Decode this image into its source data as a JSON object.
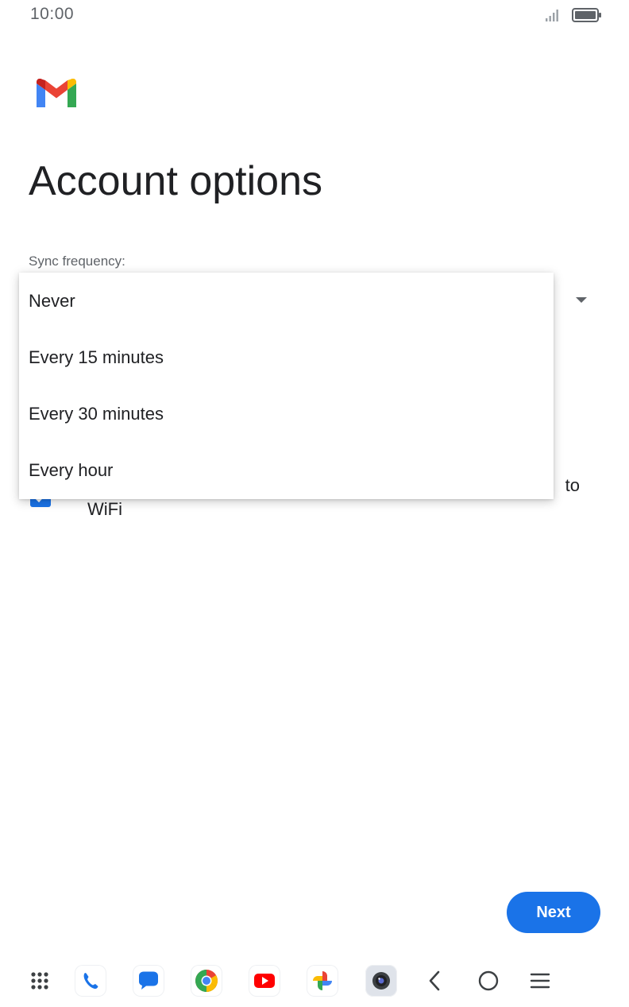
{
  "status_bar": {
    "time": "10:00",
    "icons": [
      "signal-icon",
      "battery-icon"
    ]
  },
  "app": {
    "logo": "gmail-logo",
    "colors": {
      "red": "#ea4335",
      "blue": "#4285f4",
      "green": "#34a853",
      "yellow": "#fbbc04",
      "accent": "#1a73e8"
    }
  },
  "page": {
    "title": "Account options"
  },
  "sync": {
    "label": "Sync frequency:",
    "options": [
      "Never",
      "Every 15 minutes",
      "Every 30 minutes",
      "Every hour"
    ]
  },
  "wifi_option": {
    "label_visible_end": "to",
    "label_line2": "WiFi",
    "checked": true
  },
  "actions": {
    "next_label": "Next"
  },
  "navigation": {
    "items": [
      "apps-grid-icon",
      "phone-icon",
      "messages-icon",
      "chrome-icon",
      "youtube-icon",
      "photos-icon",
      "camera-icon",
      "back-icon",
      "home-icon",
      "recents-icon"
    ]
  }
}
